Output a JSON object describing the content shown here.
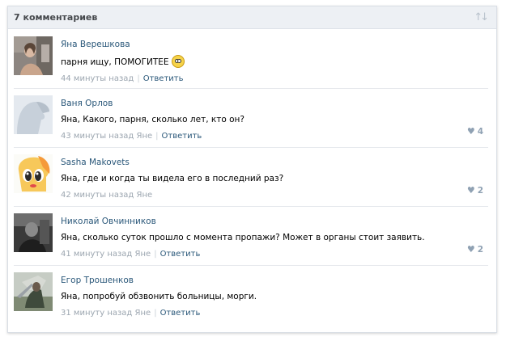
{
  "header": {
    "title": "7 комментариев",
    "sort_icon": "sort-arrows-icon"
  },
  "comments": [
    {
      "author": "Яна Верешкова",
      "text": "парня ищу, ПОМОГИТЕЕ",
      "emoji": "smiley-emoji-icon",
      "time": "44 минуты назад",
      "reply_to": "",
      "reply": "Ответить",
      "likes": ""
    },
    {
      "author": "Ваня Орлов",
      "text": "Яна, Какого, парня, сколько лет, кто он?",
      "time": "43 минуты назад",
      "reply_to": "Яне",
      "reply": "Ответить",
      "likes": "4"
    },
    {
      "author": "Sasha Makovets",
      "text": "Яна, где и когда ты видела его в последний раз?",
      "time": "42 минуты назад",
      "reply_to": "Яне",
      "reply": "",
      "likes": "2"
    },
    {
      "author": "Николай Овчинников",
      "text": "Яна, сколько суток прошло с момента пропажи? Может в органы стоит заявить.",
      "time": "41 минуту назад",
      "reply_to": "Яне",
      "reply": "Ответить",
      "likes": "2"
    },
    {
      "author": "Егор Трошенков",
      "text": "Яна, попробуй обзвонить больницы, морги.",
      "time": "31 минуту назад",
      "reply_to": "Яне",
      "reply": "Ответить",
      "likes": ""
    }
  ]
}
